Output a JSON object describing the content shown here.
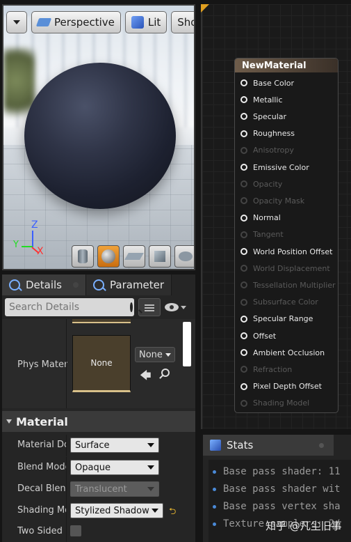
{
  "viewport": {
    "toolbar": {
      "perspective_label": "Perspective",
      "lit_label": "Lit",
      "show_label": "Show"
    },
    "axis": {
      "z": "Z",
      "x": "X",
      "y": "Y"
    }
  },
  "details": {
    "tabs": [
      {
        "label": "Details"
      },
      {
        "label": "Parameter"
      }
    ],
    "search": {
      "placeholder": "Search Details"
    },
    "phys_material": {
      "label": "Phys Materi",
      "thumb_text": "None",
      "combo_value": "None"
    },
    "section": "Material",
    "properties": [
      {
        "label": "Material Dor",
        "value": "Surface"
      },
      {
        "label": "Blend Mode",
        "value": "Opaque"
      },
      {
        "label": "Decal Blend",
        "value": "Translucent"
      },
      {
        "label": "Shading Mo",
        "value": "Stylized Shadow"
      },
      {
        "label": "Two Sided",
        "value": ""
      }
    ]
  },
  "node": {
    "title": "NewMaterial",
    "pins": [
      {
        "label": "Base Color",
        "enabled": true
      },
      {
        "label": "Metallic",
        "enabled": true
      },
      {
        "label": "Specular",
        "enabled": true
      },
      {
        "label": "Roughness",
        "enabled": true
      },
      {
        "label": "Anisotropy",
        "enabled": false
      },
      {
        "label": "Emissive Color",
        "enabled": true
      },
      {
        "label": "Opacity",
        "enabled": false
      },
      {
        "label": "Opacity Mask",
        "enabled": false
      },
      {
        "label": "Normal",
        "enabled": true
      },
      {
        "label": "Tangent",
        "enabled": false
      },
      {
        "label": "World Position Offset",
        "enabled": true
      },
      {
        "label": "World Displacement",
        "enabled": false
      },
      {
        "label": "Tessellation Multiplier",
        "enabled": false
      },
      {
        "label": "Subsurface Color",
        "enabled": false
      },
      {
        "label": "Specular Range",
        "enabled": true
      },
      {
        "label": "Offset",
        "enabled": true
      },
      {
        "label": "Ambient Occlusion",
        "enabled": true
      },
      {
        "label": "Refraction",
        "enabled": false
      },
      {
        "label": "Pixel Depth Offset",
        "enabled": true
      },
      {
        "label": "Shading Model",
        "enabled": false
      }
    ]
  },
  "stats": {
    "tab_label": "Stats",
    "lines": [
      "Base pass shader: 11",
      "Base pass shader wit",
      "Base pass vertex sha",
      "Texture samplers: 2/"
    ]
  },
  "watermark": "知乎 @凡尘旧事"
}
